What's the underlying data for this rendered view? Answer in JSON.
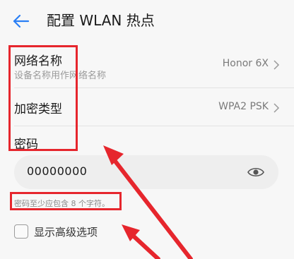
{
  "header": {
    "title": "配置 WLAN 热点",
    "back_icon": "arrow-left-icon",
    "accent_color": "#2a7ff5"
  },
  "network_name": {
    "label": "网络名称",
    "sublabel": "设备名称用作网络名称",
    "value": "Honor 6X",
    "icon": "chevron-right-icon"
  },
  "encryption": {
    "label": "加密类型",
    "value": "WPA2 PSK",
    "icon": "chevron-right-icon"
  },
  "password": {
    "label": "密码",
    "value": "00000000",
    "icon": "eye-icon",
    "hint": "密码至少应包含 8 个字符。"
  },
  "advanced": {
    "label": "显示高级选项",
    "checked": false
  },
  "annotation_color": "#e6262d"
}
